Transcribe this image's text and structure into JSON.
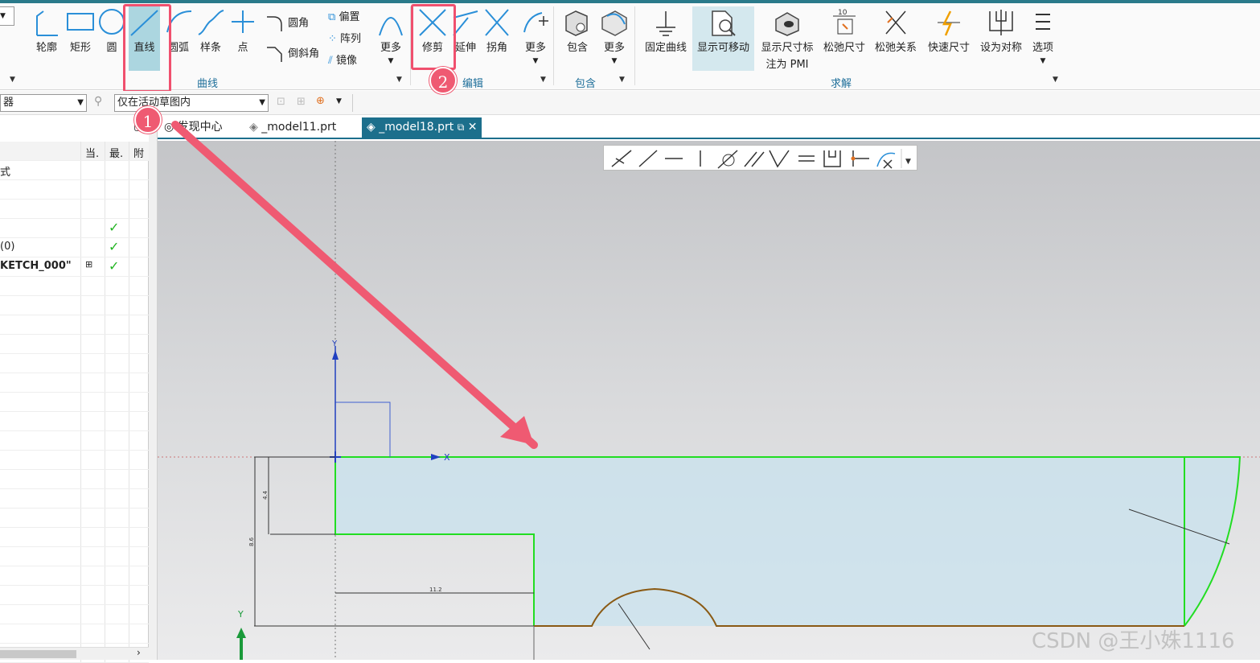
{
  "ribbon": {
    "curve_group": "曲线",
    "edit_group": "编辑",
    "include_group": "包含",
    "solve_group": "求解",
    "buttons": {
      "profile": "轮廓",
      "rectangle": "矩形",
      "circle": "圆",
      "line": "直线",
      "arc": "圆弧",
      "spline": "样条",
      "point": "点",
      "fillet": "圆角",
      "chamfer": "倒斜角",
      "offset": "偏置",
      "array": "阵列",
      "mirror": "镜像",
      "more_curve": "更多",
      "trim": "修剪",
      "extend": "延伸",
      "corner": "拐角",
      "more_edit": "更多",
      "include": "包含",
      "more_include": "更多",
      "fix_curve": "固定曲线",
      "show_movable": "显示可移动",
      "show_dim_pmi_1": "显示尺寸标",
      "show_dim_pmi_2": "注为 PMI",
      "relax_dim": "松弛尺寸",
      "relax_rel": "松弛关系",
      "quick_dim": "快速尺寸",
      "set_symmetric": "设为对称",
      "options": "选项"
    },
    "highlight_colors": {
      "box": "#f0506e",
      "badge": "#ef5a72"
    }
  },
  "annotations": {
    "badge1": "1",
    "badge2": "2"
  },
  "filterbar": {
    "left_combo": "器",
    "scope_combo": "仅在活动草图内"
  },
  "tabs": [
    {
      "label": "发现中心"
    },
    {
      "label": "_model11.prt"
    },
    {
      "label": "_model18.prt"
    }
  ],
  "navigator": {
    "columns": [
      "当.",
      "最.",
      "附"
    ],
    "rows": [
      {
        "name": "式",
        "check": ""
      },
      {
        "name": "",
        "check": ""
      },
      {
        "name": "",
        "check": ""
      },
      {
        "name": "",
        "check": "✓"
      },
      {
        "name": "(0)",
        "check": "✓"
      },
      {
        "name": "KETCH_000\"",
        "check": "✓"
      }
    ]
  },
  "sketch": {
    "axis_x": "X",
    "axis_y": "Y",
    "dim_44": "4.4",
    "dim_86": "8.6",
    "dim_112": "11.2",
    "profile_color": "#22dd22",
    "arc_color": "#8a5a14"
  },
  "watermark": "CSDN @王小姝1116"
}
